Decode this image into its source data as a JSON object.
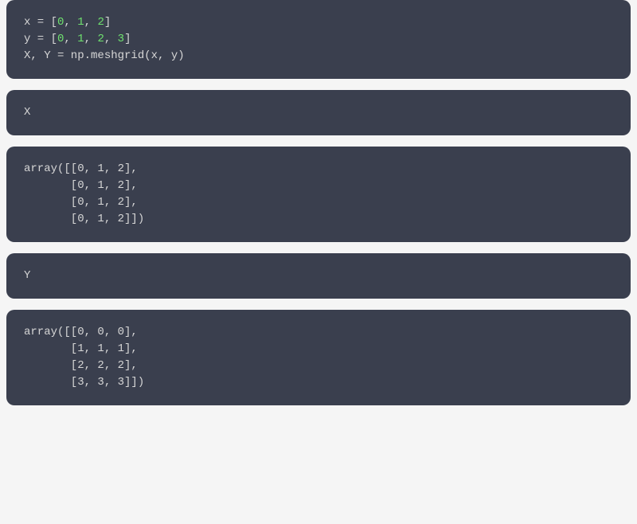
{
  "cell1": {
    "line1_prefix": "x = [",
    "line1_n1": "0",
    "line1_sep": ", ",
    "line1_n2": "1",
    "line1_n3": "2",
    "line1_suffix": "]",
    "line2_prefix": "y = [",
    "line2_n1": "0",
    "line2_n2": "1",
    "line2_n3": "2",
    "line2_n4": "3",
    "line2_suffix": "]",
    "line3_blank": "",
    "line4": "X, Y = np.meshgrid(x, y)"
  },
  "cell2": {
    "line1": "X"
  },
  "cell3": {
    "line1": "array([[0, 1, 2],",
    "line2": "       [0, 1, 2],",
    "line3": "       [0, 1, 2],",
    "line4": "       [0, 1, 2]])"
  },
  "cell4": {
    "line1": "Y"
  },
  "cell5": {
    "line1": "array([[0, 0, 0],",
    "line2": "       [1, 1, 1],",
    "line3": "       [2, 2, 2],",
    "line4": "       [3, 3, 3]])"
  }
}
